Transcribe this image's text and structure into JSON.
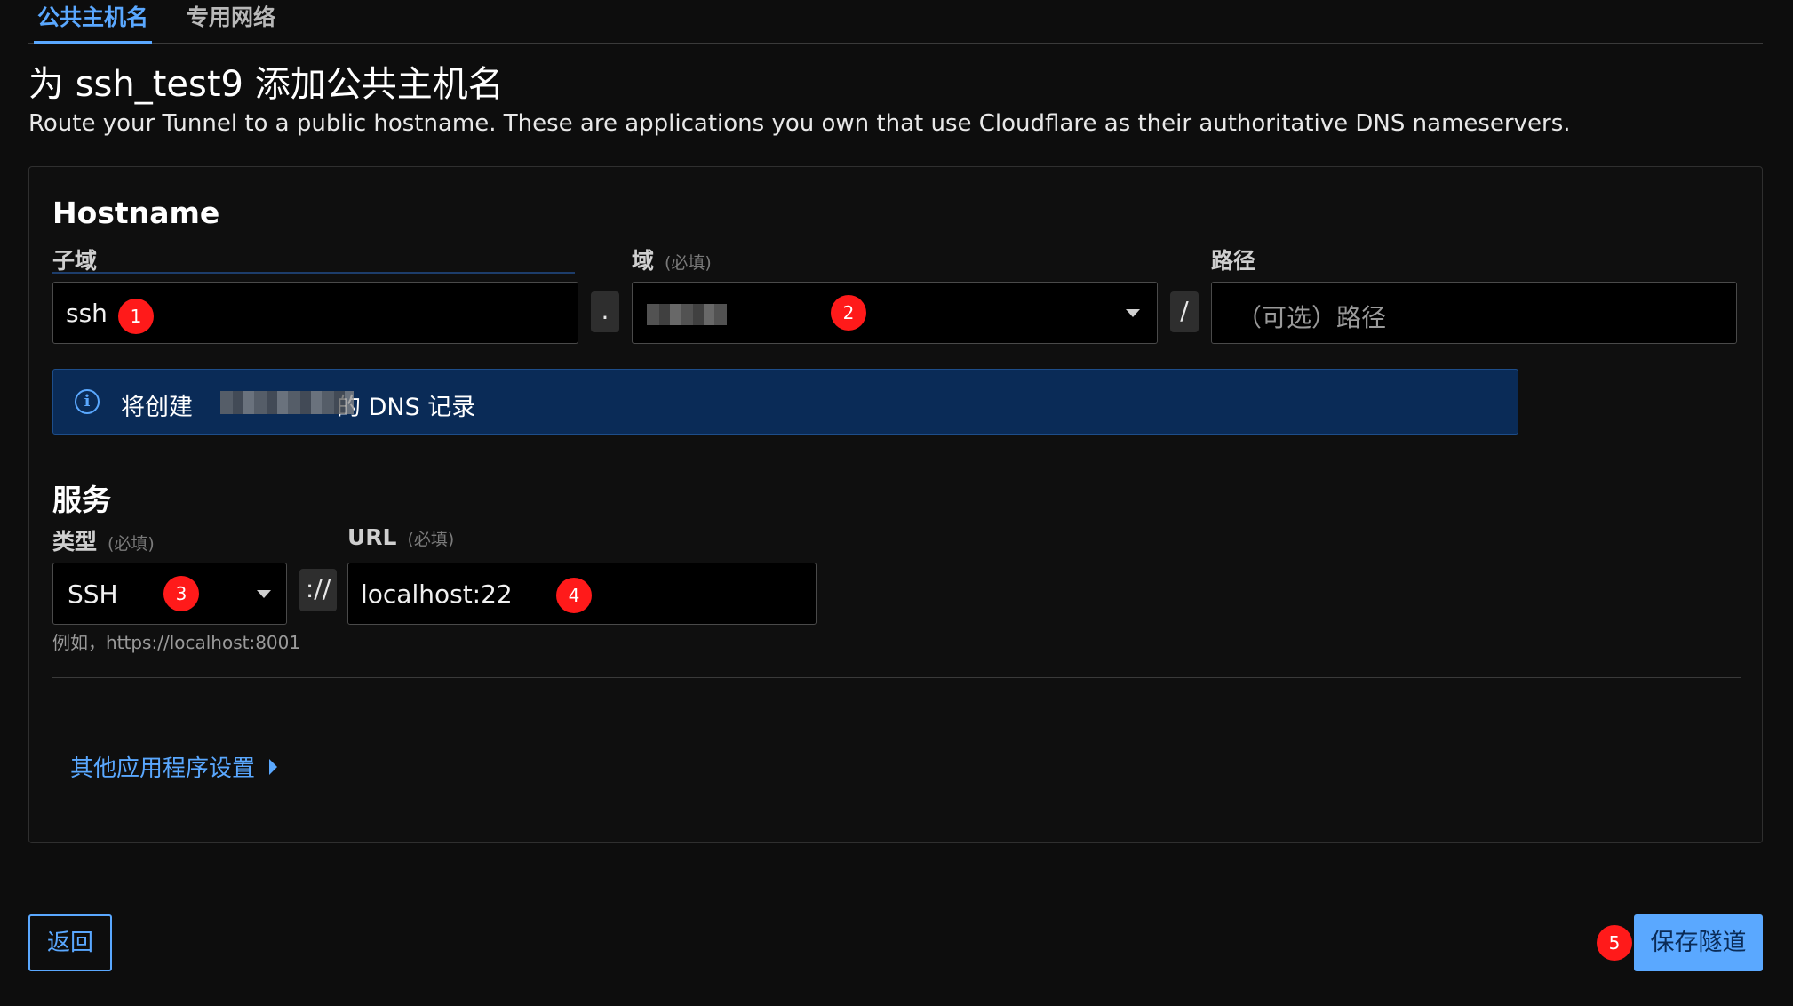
{
  "tabs": [
    {
      "label": "公共主机名",
      "active": true
    },
    {
      "label": "专用网络",
      "active": false
    }
  ],
  "page": {
    "title": "为 ssh_test9 添加公共主机名",
    "subtitle": "Route your Tunnel to a public hostname. These are applications you own that use Cloudflare as their authoritative DNS nameservers."
  },
  "hostname": {
    "heading": "Hostname",
    "subdomain": {
      "label": "子域",
      "value": "ssh"
    },
    "dot_separator": ".",
    "domain": {
      "label": "域",
      "required": "(必填)",
      "value_redacted": true
    },
    "slash_separator": "/",
    "path": {
      "label": "路径",
      "placeholder": "（可选）路径",
      "value": ""
    }
  },
  "info_banner": {
    "prefix": "将创建",
    "suffix": "的 DNS 记录",
    "icon": "info-icon"
  },
  "service": {
    "heading": "服务",
    "type": {
      "label": "类型",
      "required": "(必填)",
      "value": "SSH"
    },
    "scheme_separator": "://",
    "url": {
      "label": "URL",
      "required": "(必填)",
      "value": "localhost:22"
    },
    "help": "例如，https://localhost:8001"
  },
  "more_settings": {
    "label": "其他应用程序设置"
  },
  "footer": {
    "back_label": "返回",
    "save_label": "保存隧道"
  },
  "annotations": [
    "1",
    "2",
    "3",
    "4",
    "5"
  ],
  "colors": {
    "background": "#0d0d0d",
    "accent": "#5aa8ff",
    "info_bg": "#0a2b57",
    "badge": "#ff1a1a"
  }
}
